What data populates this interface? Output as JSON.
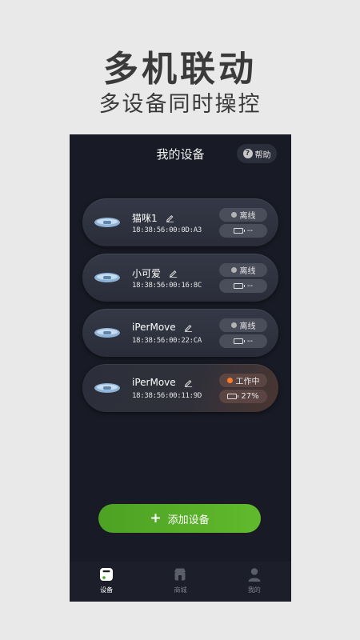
{
  "promo": {
    "title": "多机联动",
    "subtitle": "多设备同时操控"
  },
  "header": {
    "title": "我的设备",
    "help_label": "帮助",
    "help_icon_glyph": "?"
  },
  "devices": [
    {
      "name": "猫咪1",
      "mac": "18:38:56:00:0D:A3",
      "status": "离线",
      "battery": "--",
      "active": false
    },
    {
      "name": "小可爱",
      "mac": "18:38:56:00:16:8C",
      "status": "离线",
      "battery": "--",
      "active": false
    },
    {
      "name": "iPerMove",
      "mac": "18:38:56:00:22:CA",
      "status": "离线",
      "battery": "--",
      "active": false
    },
    {
      "name": "iPerMove",
      "mac": "18:38:56:00:11:9D",
      "status": "工作中",
      "battery": "27%",
      "active": true
    }
  ],
  "add_button": {
    "label": "添加设备",
    "icon": "plus-icon"
  },
  "tabs": [
    {
      "label": "设备",
      "icon": "device-icon",
      "active": true
    },
    {
      "label": "商城",
      "icon": "shop-icon",
      "active": false
    },
    {
      "label": "我的",
      "icon": "profile-icon",
      "active": false
    }
  ],
  "colors": {
    "background": "#e9e9e9",
    "app_background": "#181a25",
    "accent_green": "#5cb52b",
    "status_working": "#ff7a2a",
    "status_offline": "#b3b3b3"
  }
}
